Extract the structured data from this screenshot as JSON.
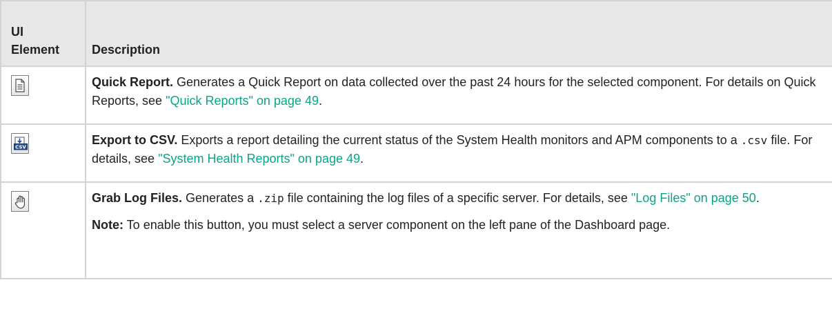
{
  "table": {
    "header": {
      "col1_line1": "UI",
      "col1_line2": "Element",
      "col2": "Description"
    },
    "rows": [
      {
        "icon": "quick-report-icon",
        "title": "Quick Report.",
        "text": " Generates a Quick Report on data collected over the past 24 hours for the selected component. For details on Quick Reports, see ",
        "link": "\"Quick Reports\" on page 49",
        "end": "."
      },
      {
        "icon": "export-csv-icon",
        "title": "Export to CSV.",
        "text_a": " Exports a report detailing the current status of the System Health monitors and APM components to a ",
        "code": ".csv",
        "text_b": " file. For details, see ",
        "link": "\"System Health Reports\" on page 49",
        "end": "."
      },
      {
        "icon": "grab-log-files-icon",
        "title": "Grab Log Files.",
        "text_a": " Generates a ",
        "code": ".zip",
        "text_b": " file containing the log files of a specific server. For details, see ",
        "link": "\"Log Files\" on page 50",
        "end": ".",
        "note_label": "Note:",
        "note_text": " To enable this button, you must select a server component on the left pane of the Dashboard page."
      }
    ]
  },
  "colors": {
    "link": "#0aa488",
    "header_bg": "#e8e8e8",
    "border": "#d3d3d3"
  }
}
